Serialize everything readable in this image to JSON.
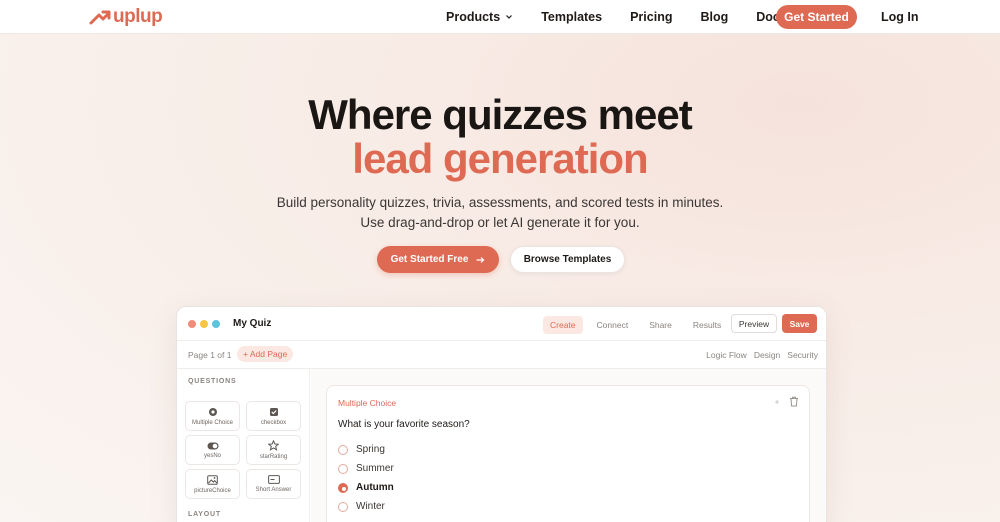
{
  "nav": {
    "brand": "uplup",
    "links": [
      "Products",
      "Templates",
      "Pricing",
      "Blog",
      "Docs"
    ],
    "cta": "Get Started",
    "login": "Log In"
  },
  "hero": {
    "title": "Where quizzes meet",
    "accent": "lead generation",
    "sub_line1": "Build personality quizzes, trivia, assessments, and scored tests in minutes.",
    "sub_line2": "Use drag-and-drop or let AI generate it for you.",
    "primary": "Get Started Free",
    "secondary": "Browse Templates"
  },
  "app": {
    "title": "My Quiz",
    "tabs": [
      "Create",
      "Connect",
      "Share",
      "Results"
    ],
    "preview": "Preview",
    "save": "Save",
    "page_info": "Page 1 of 1",
    "add_page": "+ Add Page",
    "sub_links": [
      "Logic Flow",
      "Design",
      "Security"
    ],
    "questions_heading": "QUESTIONS",
    "layout_heading": "LAYOUT",
    "question_types": [
      "Multiple Choice",
      "checkbox",
      "yesNo",
      "starRating",
      "pictureChoice",
      "Short Answer"
    ],
    "question": {
      "type": "Multiple Choice",
      "text": "What is your favorite season?",
      "options": [
        "Spring",
        "Summer",
        "Autumn",
        "Winter"
      ],
      "selected": "Autumn"
    }
  },
  "colors": {
    "accent": "#de6a53",
    "dot_red": "#f08b7a",
    "dot_yellow": "#f5c543",
    "dot_blue": "#5cc3dc"
  }
}
